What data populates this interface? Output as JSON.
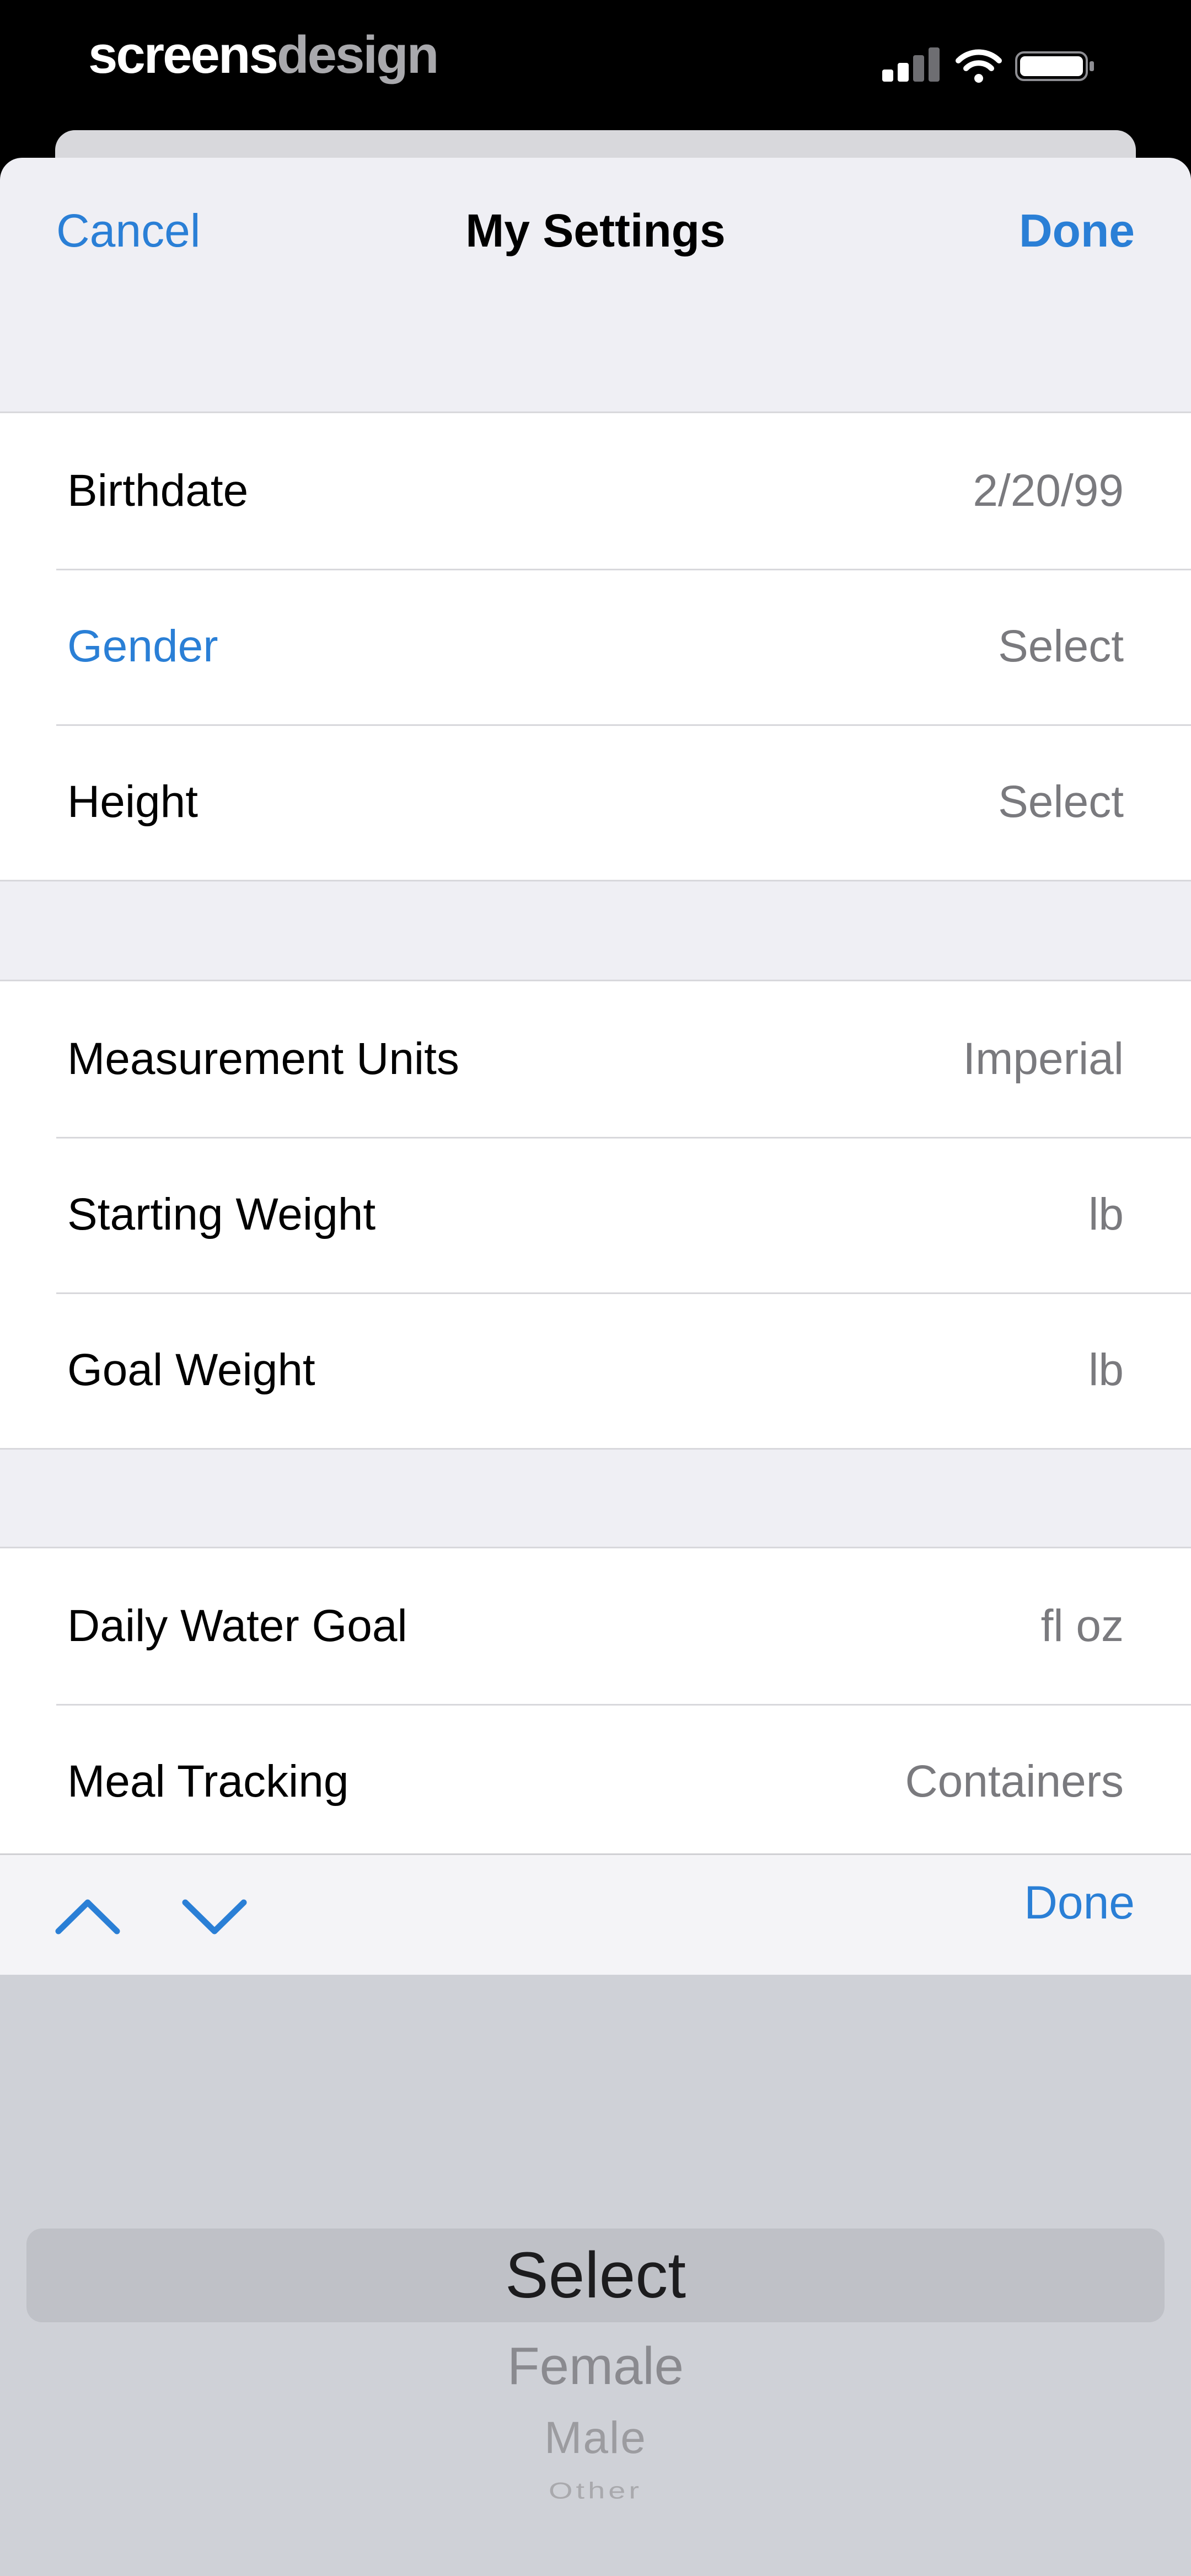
{
  "status_bar": {
    "brand_part1": "screens",
    "brand_part2": "design",
    "icons": [
      "cellular-signal-icon",
      "wifi-icon",
      "battery-icon"
    ]
  },
  "nav": {
    "cancel_label": "Cancel",
    "title": "My Settings",
    "done_label": "Done"
  },
  "groups": [
    {
      "rows": [
        {
          "label": "Birthdate",
          "value": "2/20/99"
        },
        {
          "label": "Gender",
          "value": "Select"
        },
        {
          "label": "Height",
          "value": "Select"
        }
      ]
    },
    {
      "rows": [
        {
          "label": "Measurement Units",
          "value": "Imperial"
        },
        {
          "label": "Starting Weight",
          "value": "lb"
        },
        {
          "label": "Goal Weight",
          "value": "lb"
        }
      ]
    },
    {
      "rows": [
        {
          "label": "Daily Water Goal",
          "value": "fl oz"
        },
        {
          "label": "Meal Tracking",
          "value": "Containers"
        }
      ]
    }
  ],
  "toolbar": {
    "done_label": "Done",
    "prev_icon": "chevron-up-icon",
    "next_icon": "chevron-down-icon"
  },
  "picker": {
    "selected": "Select",
    "options": [
      "Female",
      "Male",
      "Other"
    ]
  },
  "colors": {
    "accent": "#2a7fd6",
    "background": "#efeff4",
    "picker_background": "#cfd1d7"
  }
}
